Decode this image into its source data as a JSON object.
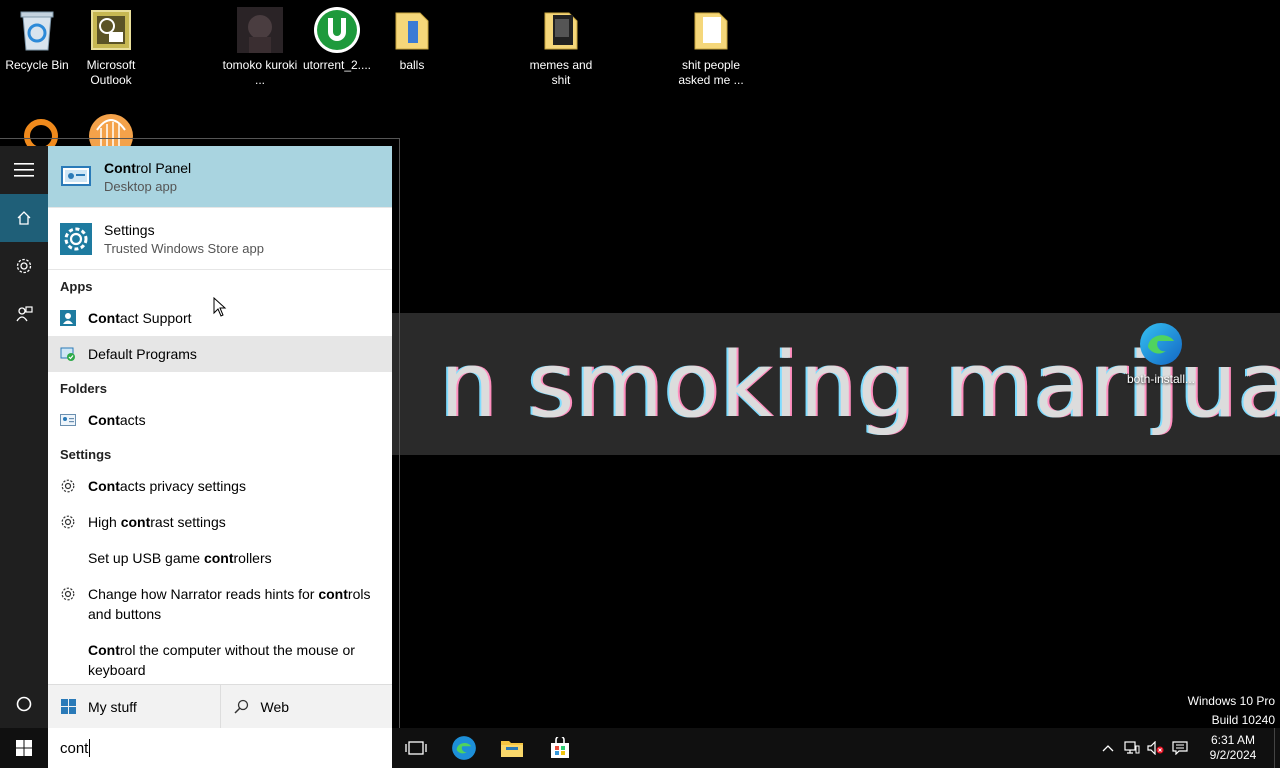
{
  "desktop": {
    "icons": [
      {
        "label": "Recycle Bin",
        "icon": "recycle-bin-icon"
      },
      {
        "label": "Microsoft Outlook",
        "icon": "outlook-icon"
      },
      {
        "label": "tomoko kuroki ...",
        "icon": "image-thumbnail-icon"
      },
      {
        "label": "utorrent_2....",
        "icon": "utorrent-icon"
      },
      {
        "label": "balls",
        "icon": "folder-icon"
      },
      {
        "label": "memes and shit",
        "icon": "folder-icon"
      },
      {
        "label": "shit people asked me ...",
        "icon": "folder-icon"
      },
      {
        "label": "both-install...",
        "icon": "edge-icon"
      }
    ],
    "wallpaper_text": "n smoking marijuana"
  },
  "start_rail": {
    "items": [
      "menu-icon",
      "home-icon",
      "settings-icon",
      "feedback-icon",
      "cortana-icon"
    ]
  },
  "search_panel": {
    "best_matches": [
      {
        "bold": "Cont",
        "rest": "rol Panel",
        "subtitle": "Desktop app",
        "icon": "control-panel-icon"
      },
      {
        "bold": "",
        "rest": "Settings",
        "subtitle": "Trusted Windows Store app",
        "icon": "settings-icon"
      }
    ],
    "apps_header": "Apps",
    "apps": [
      {
        "bold": "Cont",
        "rest": "act Support"
      },
      {
        "bold": "",
        "rest": "Default Programs"
      }
    ],
    "folders_header": "Folders",
    "folders": [
      {
        "bold": "Cont",
        "rest": "acts"
      }
    ],
    "settings_header": "Settings",
    "settings": [
      {
        "pre": "",
        "bold": "Cont",
        "rest": "acts privacy settings"
      },
      {
        "pre": "High ",
        "bold": "cont",
        "rest": "rast settings"
      },
      {
        "pre": "Set up USB game ",
        "bold": "cont",
        "rest": "rollers"
      },
      {
        "pre": "Change how Narrator reads hints for ",
        "bold": "cont",
        "rest": "rols and buttons"
      },
      {
        "pre": "",
        "bold": "Cont",
        "rest": "rol the computer without the mouse or keyboard"
      }
    ],
    "scope": {
      "mystuff": "My stuff",
      "web": "Web"
    }
  },
  "taskbar": {
    "search_value": "cont",
    "clock_time": "6:31 AM",
    "clock_date": "9/2/2024"
  },
  "watermark": {
    "line1": "Windows 10 Pro",
    "line2": "Build 10240"
  },
  "colors": {
    "selected": "#a9d4e0",
    "rail_active": "#1f5f78",
    "accent": "#1e7ba0"
  }
}
